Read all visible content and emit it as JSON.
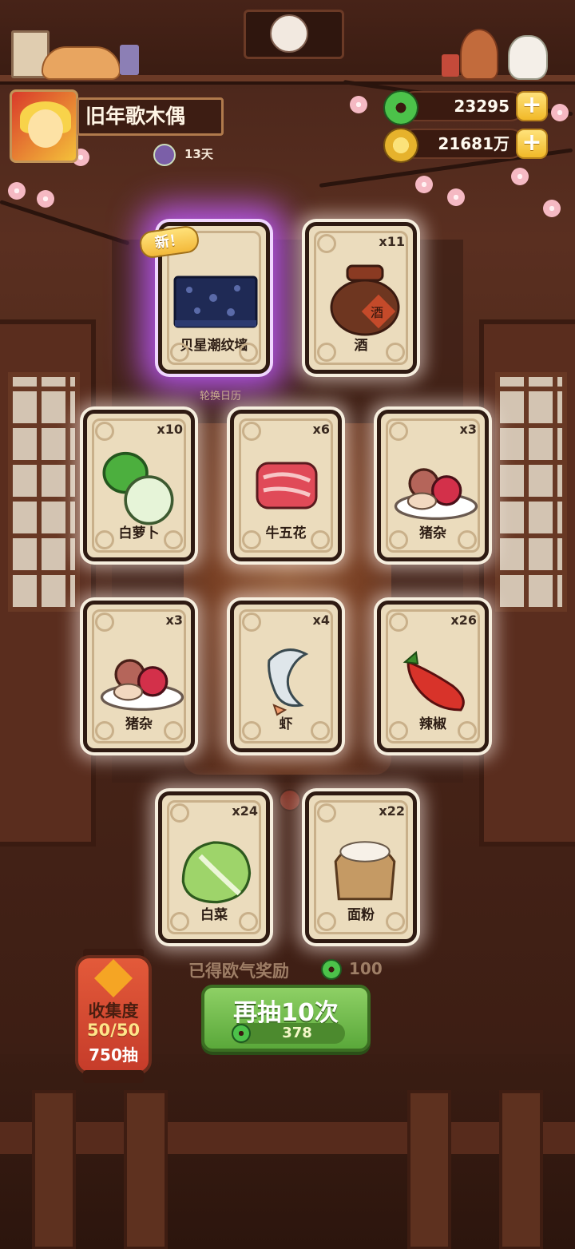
{
  "header": {
    "player_name": "旧年歌木偶",
    "days_label": "13天"
  },
  "currency": {
    "jade": "23295",
    "coins": "21681万",
    "plus_label": "+"
  },
  "new_badge": "新！",
  "under_label": "轮换日历",
  "cards": [
    {
      "name": "贝星潮纹墙",
      "count": "",
      "icon": "wall-tile-icon",
      "special": true
    },
    {
      "name": "酒",
      "count": "x11",
      "icon": "wine-jar-icon"
    },
    {
      "name": "白萝卜",
      "count": "x10",
      "icon": "white-radish-icon"
    },
    {
      "name": "牛五花",
      "count": "x6",
      "icon": "beef-belly-icon"
    },
    {
      "name": "猪杂",
      "count": "x3",
      "icon": "pork-offal-icon"
    },
    {
      "name": "猪杂",
      "count": "x3",
      "icon": "pork-offal-icon"
    },
    {
      "name": "虾",
      "count": "x4",
      "icon": "shrimp-icon"
    },
    {
      "name": "辣椒",
      "count": "x26",
      "icon": "chili-icon"
    },
    {
      "name": "白菜",
      "count": "x24",
      "icon": "cabbage-icon"
    },
    {
      "name": "面粉",
      "count": "x22",
      "icon": "flour-sack-icon"
    }
  ],
  "jar_char": "酒",
  "collection": {
    "title": "收集度",
    "progress": "50/50",
    "draws": "750抽"
  },
  "reward": {
    "label": "已得欧气奖励",
    "value": "100"
  },
  "draw_button": {
    "label": "再抽10次",
    "cost": "378"
  },
  "colors": {
    "jade_green": "#4cc24a",
    "button_green": "#6fbd4a",
    "lantern_red": "#d84a32",
    "gold": "#f3b93a",
    "card_bg": "#ebdcbd",
    "special_glow": "#b45cff"
  }
}
